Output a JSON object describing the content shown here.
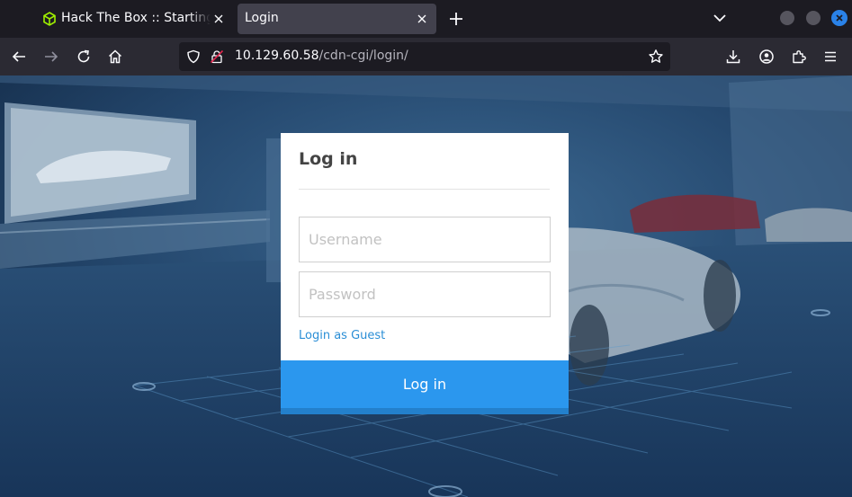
{
  "browser": {
    "tabs": [
      {
        "title": "Hack The Box :: Starting Point",
        "active": false,
        "favicon": "htb-cube-icon"
      },
      {
        "title": "Login",
        "active": true
      }
    ],
    "url": {
      "host": "10.129.60.58",
      "path": "/cdn-cgi/login/"
    },
    "accent": "#2a82e8"
  },
  "login": {
    "title": "Log in",
    "username_placeholder": "Username",
    "password_placeholder": "Password",
    "guest_link": "Login as Guest",
    "submit_label": "Log in",
    "button_color": "#2b97ee",
    "link_color": "#2a8ed6"
  }
}
